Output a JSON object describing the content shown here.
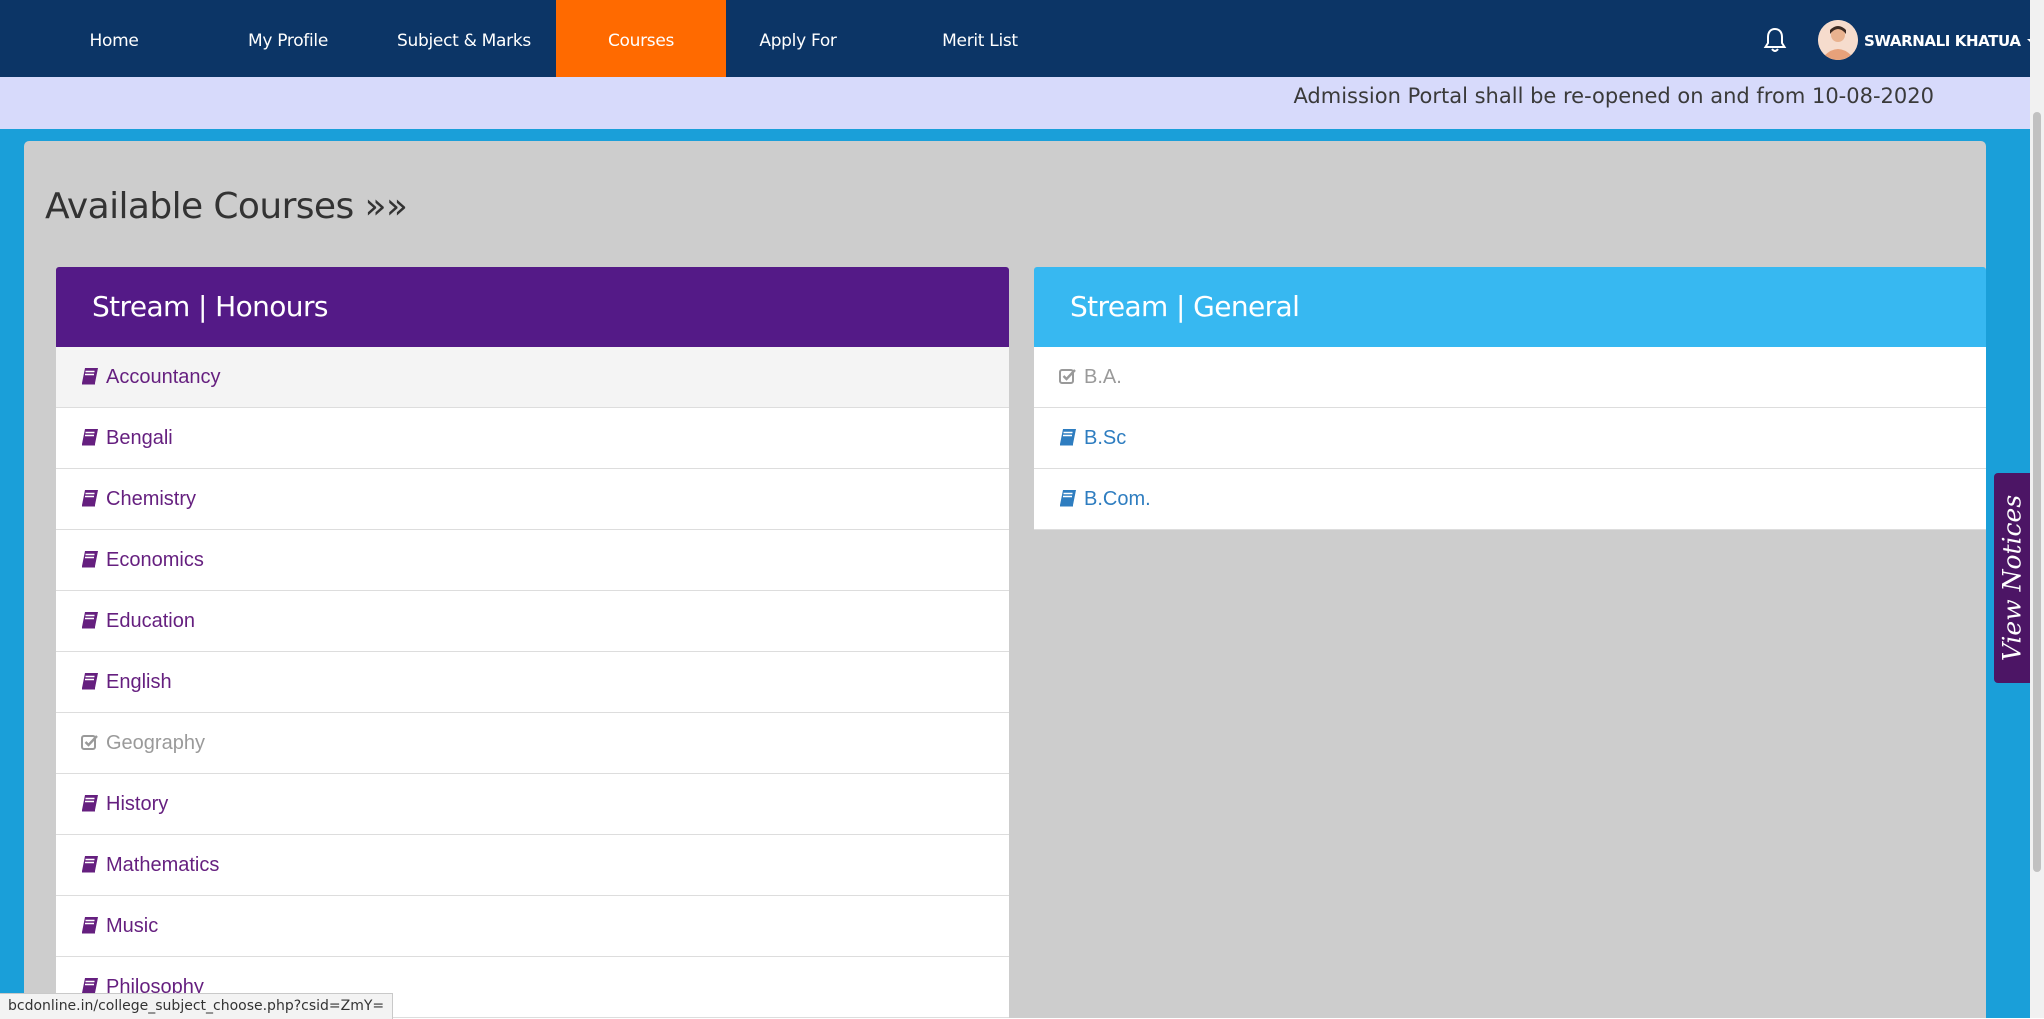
{
  "nav": {
    "items": [
      {
        "label": "Home",
        "active": false
      },
      {
        "label": "My Profile",
        "active": false
      },
      {
        "label": "Subject & Marks",
        "active": false
      },
      {
        "label": "Courses",
        "active": true
      },
      {
        "label": "Apply For",
        "active": false
      },
      {
        "label": "Merit List",
        "active": false
      }
    ],
    "user_name": "SWARNALI KHATUA",
    "icons": [
      "bell-icon",
      "avatar",
      "caret-down-icon"
    ]
  },
  "notice": {
    "text": "Admission Portal shall be re-opened on and from 10-08-2020"
  },
  "page": {
    "title": "Available Courses »»"
  },
  "honours": {
    "header": "Stream | Honours",
    "items": [
      {
        "label": "Accountancy",
        "icon": "book-icon"
      },
      {
        "label": "Bengali",
        "icon": "book-icon"
      },
      {
        "label": "Chemistry",
        "icon": "book-icon"
      },
      {
        "label": "Economics",
        "icon": "book-icon"
      },
      {
        "label": "Education",
        "icon": "book-icon"
      },
      {
        "label": "English",
        "icon": "book-icon"
      },
      {
        "label": "Geography",
        "icon": "check-square-icon"
      },
      {
        "label": "History",
        "icon": "book-icon"
      },
      {
        "label": "Mathematics",
        "icon": "book-icon"
      },
      {
        "label": "Music",
        "icon": "book-icon"
      },
      {
        "label": "Philosophy",
        "icon": "book-icon"
      }
    ]
  },
  "general": {
    "header": "Stream | General",
    "items": [
      {
        "label": "B.A.",
        "icon": "check-square-icon"
      },
      {
        "label": "B.Sc",
        "icon": "book-icon"
      },
      {
        "label": "B.Com.",
        "icon": "book-icon"
      }
    ]
  },
  "side_tab": {
    "label": "View Notices"
  },
  "status_bar": {
    "url": "bcdonline.in/college_subject_choose.php?csid=ZmY="
  },
  "colors": {
    "nav_bg": "#0c3566",
    "nav_active": "#ff6a00",
    "notice_bg": "#d7dafb",
    "frame_blue": "#1a9fd9",
    "honours_header": "#541a87",
    "general_header": "#37b8f1",
    "honours_text": "#651f7f",
    "general_text": "#2e7dc0",
    "notices_tab": "#4c1565"
  }
}
